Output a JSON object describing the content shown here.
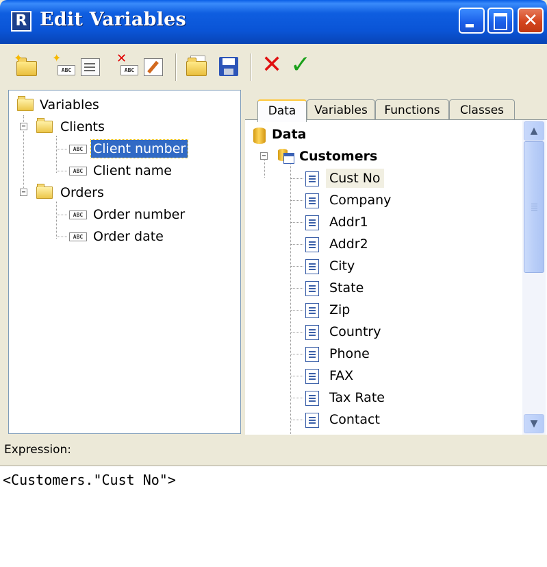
{
  "window": {
    "title": "Edit Variables",
    "app_icon_letter": "R"
  },
  "titlebar_buttons": [
    "minimize",
    "maximize",
    "close"
  ],
  "toolbar": {
    "items": [
      {
        "name": "new-category",
        "icon": "folder-new-icon"
      },
      {
        "name": "new-variable",
        "icon": "abc-new-icon"
      },
      {
        "name": "edit-properties",
        "icon": "properties-icon"
      },
      {
        "name": "delete",
        "icon": "abc-delete-icon"
      },
      {
        "name": "edit",
        "icon": "edit-icon"
      },
      {
        "name": "open",
        "icon": "open-folder-icon"
      },
      {
        "name": "save",
        "icon": "floppy-save-icon"
      },
      {
        "name": "cancel",
        "icon": "red-x-icon"
      },
      {
        "name": "ok",
        "icon": "green-check-icon"
      }
    ]
  },
  "variables_tree": {
    "root": "Variables",
    "categories": [
      {
        "label": "Clients",
        "items": [
          "Client number",
          "Client name"
        ]
      },
      {
        "label": "Orders",
        "items": [
          "Order number",
          "Order date"
        ]
      }
    ],
    "selected": "Client number"
  },
  "tabs": [
    "Data",
    "Variables",
    "Functions",
    "Classes"
  ],
  "active_tab": "Data",
  "data_tree": {
    "root": "Data",
    "dataset": "Customers",
    "fields": [
      "Cust No",
      "Company",
      "Addr1",
      "Addr2",
      "City",
      "State",
      "Zip",
      "Country",
      "Phone",
      "FAX",
      "Tax Rate",
      "Contact"
    ],
    "highlighted": "Cust No"
  },
  "icons": {
    "abc_text": "ABC",
    "expand": "+",
    "collapse": "−",
    "up_arrow": "▲",
    "down_arrow": "▼",
    "close": "✕",
    "check": "✓"
  },
  "expression": {
    "label": "Expression:",
    "value": "<Customers.\"Cust No\">"
  },
  "colors": {
    "title_bar": "#0a54d6",
    "selection": "#316ac5",
    "face": "#ece9d8"
  }
}
